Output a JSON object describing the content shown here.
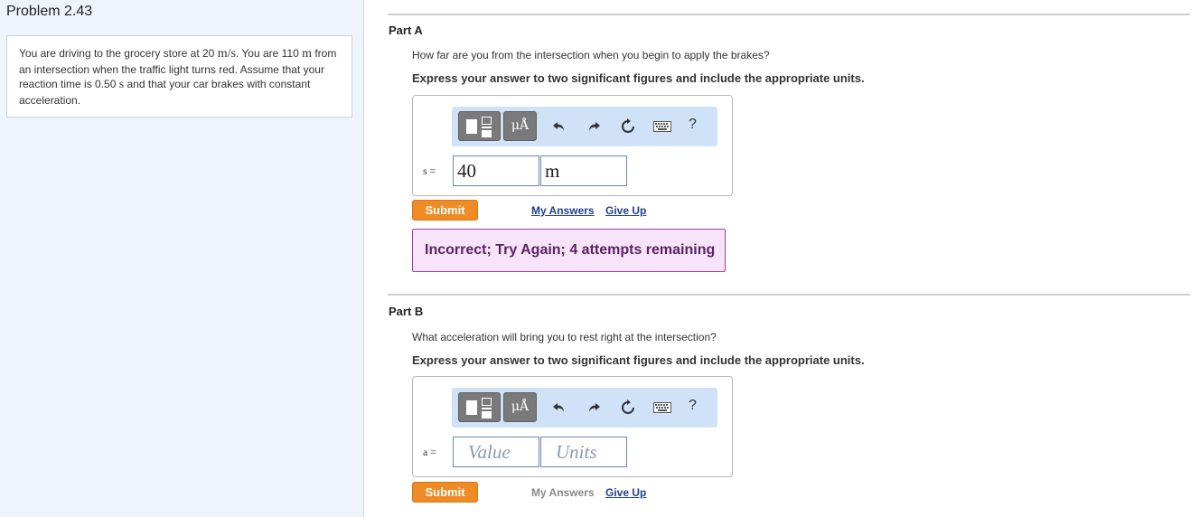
{
  "problem": {
    "title": "Problem 2.43",
    "text_1": "You are driving to the grocery store at 20 ",
    "unit_speed": "m/s",
    "text_2": ". You are 110 ",
    "unit_m": "m",
    "text_3": " from an intersection when the traffic light turns red. Assume that your reaction time is 0.50 ",
    "unit_s": "s",
    "text_4": " and that your car brakes with constant acceleration."
  },
  "toolbar": {
    "units_label": "μÅ",
    "help_label": "?"
  },
  "part_a": {
    "label": "Part A",
    "question": "How far are you from the intersection when you begin to apply the brakes?",
    "instruction": "Express your answer to two significant figures and include the appropriate units.",
    "variable": "s =",
    "value": "40",
    "units": "m",
    "submit_label": "Submit",
    "my_answers_label": "My Answers",
    "give_up_label": "Give Up",
    "feedback": "Incorrect; Try Again; 4 attempts remaining"
  },
  "part_b": {
    "label": "Part B",
    "question": "What acceleration will bring you to rest right at the intersection?",
    "instruction": "Express your answer to two significant figures and include the appropriate units.",
    "variable": "a =",
    "value_placeholder": "Value",
    "units_placeholder": "Units",
    "submit_label": "Submit",
    "my_answers_label": "My Answers",
    "give_up_label": "Give Up"
  }
}
